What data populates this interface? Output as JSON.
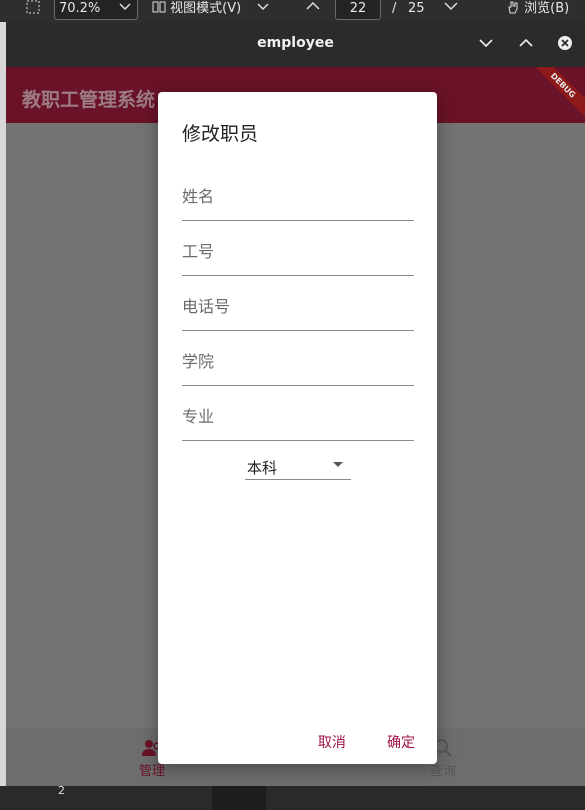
{
  "viewer_toolbar": {
    "zoom": "70.2%",
    "view_mode": "视图模式(V)",
    "current_page": "22",
    "page_separator": "/",
    "total_pages": "25",
    "browse": "浏览(B)"
  },
  "background_page": {
    "page_number": "2"
  },
  "window": {
    "title": "employee"
  },
  "app": {
    "title": "教职工管理系统",
    "debug_banner": "DEBUG"
  },
  "nav": {
    "items": [
      {
        "label": "管理",
        "icon": "people-icon",
        "selected": true
      },
      {
        "label": "查询",
        "icon": "search-icon",
        "selected": false
      }
    ]
  },
  "dialog": {
    "title": "修改职员",
    "fields": [
      {
        "placeholder": "姓名",
        "value": ""
      },
      {
        "placeholder": "工号",
        "value": ""
      },
      {
        "placeholder": "电话号",
        "value": ""
      },
      {
        "placeholder": "学院",
        "value": ""
      },
      {
        "placeholder": "专业",
        "value": ""
      }
    ],
    "degree_select": {
      "value": "本科"
    },
    "cancel_label": "取消",
    "confirm_label": "确定"
  },
  "colors": {
    "primary": "#6a1228",
    "accent": "#a0124a",
    "scrim": "#737373"
  }
}
